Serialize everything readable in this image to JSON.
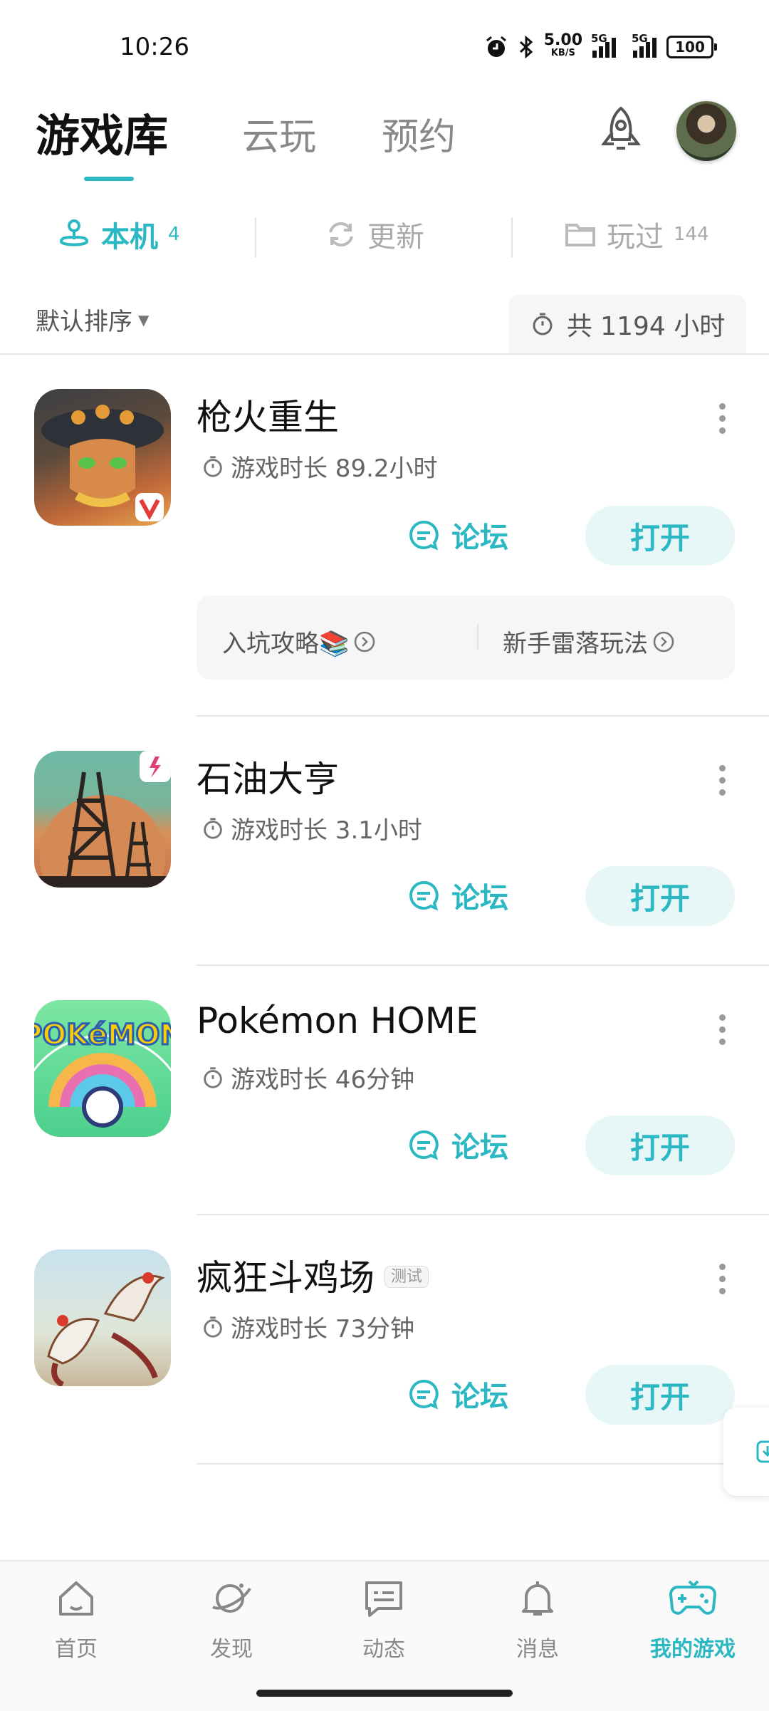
{
  "status_bar": {
    "time": "10:26",
    "net_speed": "5.00",
    "net_unit": "KB/S",
    "sig1": "5G",
    "sig2": "5G",
    "battery": "100",
    "icons": [
      "alarm-icon",
      "bluetooth-icon",
      "signal-icon",
      "battery-icon"
    ]
  },
  "top_tabs": [
    {
      "label": "游戏库",
      "active": true
    },
    {
      "label": "云玩",
      "active": false
    },
    {
      "label": "预约",
      "active": false
    }
  ],
  "sub_tabs": [
    {
      "label": "本机",
      "count": "4",
      "icon": "joystick-icon",
      "active": true
    },
    {
      "label": "更新",
      "count": "",
      "icon": "refresh-icon",
      "active": false
    },
    {
      "label": "玩过",
      "count": "144",
      "icon": "folder-icon",
      "active": false
    }
  ],
  "sort_label": "默认排序",
  "total_time": "共 1194 小时",
  "games": [
    {
      "name": "枪火重生",
      "playtime": "游戏时长 89.2小时",
      "forum": "论坛",
      "open": "打开",
      "badge": ""
    },
    {
      "name": "石油大亨",
      "playtime": "游戏时长 3.1小时",
      "forum": "论坛",
      "open": "打开",
      "badge": ""
    },
    {
      "name": "Pokémon HOME",
      "playtime": "游戏时长 46分钟",
      "forum": "论坛",
      "open": "打开",
      "badge": ""
    },
    {
      "name": "疯狂斗鸡场",
      "playtime": "游戏时长 73分钟",
      "forum": "论坛",
      "open": "打开",
      "badge": "测试"
    }
  ],
  "strategy": {
    "left": "入坑攻略📚",
    "right": "新手雷落玩法"
  },
  "bottom_nav": [
    {
      "label": "首页",
      "icon": "home-icon",
      "active": false
    },
    {
      "label": "发现",
      "icon": "planet-icon",
      "active": false
    },
    {
      "label": "动态",
      "icon": "message-icon",
      "active": false
    },
    {
      "label": "消息",
      "icon": "bell-icon",
      "active": false
    },
    {
      "label": "我的游戏",
      "icon": "gamepad-icon",
      "active": true
    }
  ],
  "colors": {
    "accent": "#2bb8c3",
    "button_bg": "#e7f6f7"
  }
}
